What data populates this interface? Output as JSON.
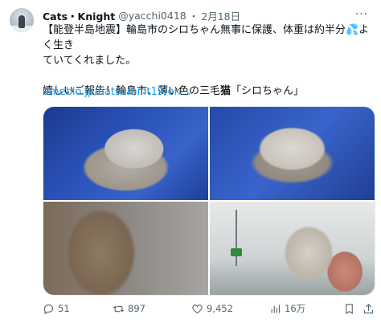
{
  "tweet": {
    "author_name": "Cats・Knight",
    "handle": "@yacchi0418",
    "separator": "・",
    "date": "2月18日",
    "more_label": "···",
    "line1": "【能登半島地震】輪島市のシロちゃん無事に保護、体重は約半分💦よく生き",
    "line2": "ていてくれました。",
    "line3_prefix": "嬉しいご報告！輪島市、薄い色の三毛",
    "line3_bold": "猫",
    "line3_suffix": "「シロちゃん」",
    "link": "ameblo.jp/natsumint19/en…"
  },
  "photos": [
    "cat-photo-1",
    "cat-photo-2",
    "cat-photo-3",
    "cat-photo-4"
  ],
  "actions": {
    "replies": "51",
    "retweets": "897",
    "likes": "9,452",
    "views": "16万"
  },
  "colors": {
    "text": "#0f1419",
    "secondary": "#536471",
    "link": "#1d9bf0"
  }
}
